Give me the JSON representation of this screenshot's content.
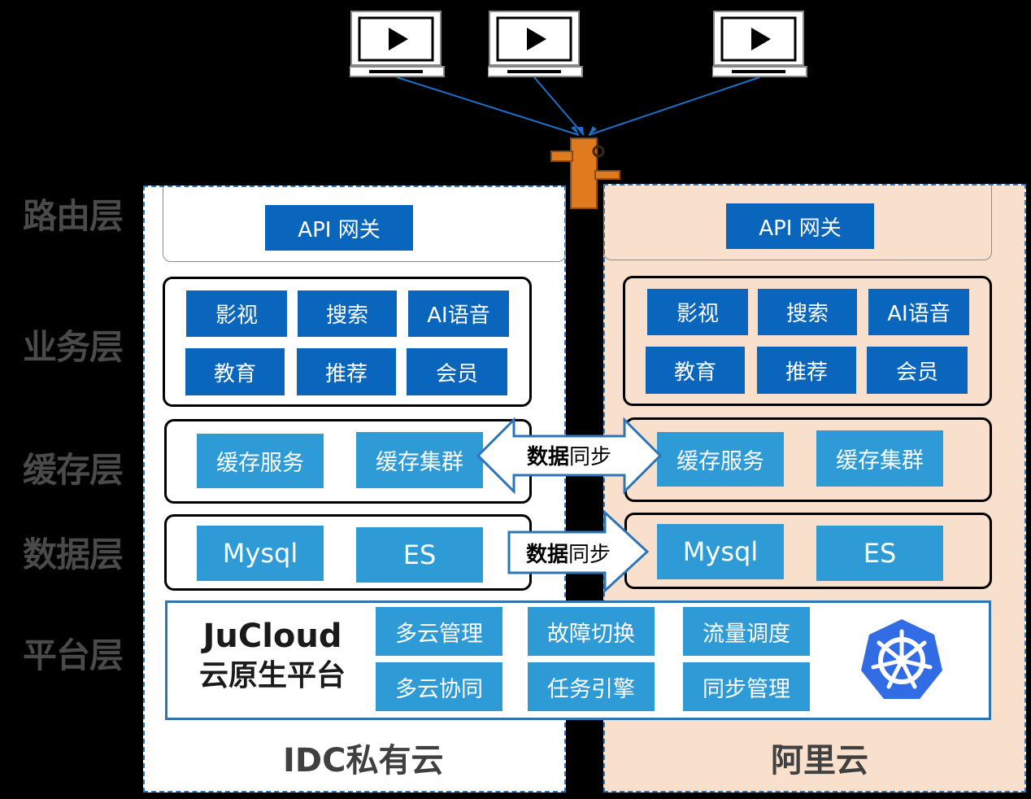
{
  "layers": {
    "route": "路由层",
    "business": "业务层",
    "cache": "缓存层",
    "data": "数据层",
    "platform": "平台层"
  },
  "idc": {
    "name": "IDC私有云",
    "gateway": "API 网关",
    "services": [
      "影视",
      "搜索",
      "AI语音",
      "教育",
      "推荐",
      "会员"
    ],
    "cache": [
      "缓存服务",
      "缓存集群"
    ],
    "data": [
      "Mysql",
      "ES"
    ]
  },
  "aliyun": {
    "name": "阿里云",
    "gateway": "API 网关",
    "services": [
      "影视",
      "搜索",
      "AI语音",
      "教育",
      "推荐",
      "会员"
    ],
    "cache": [
      "缓存服务",
      "缓存集群"
    ],
    "data": [
      "Mysql",
      "ES"
    ]
  },
  "sync": {
    "cache": {
      "bold": "数据",
      "rest": "同步"
    },
    "data": {
      "bold": "数据",
      "rest": "同步"
    }
  },
  "platform": {
    "title_line1": "JuCloud",
    "title_line2": "云原生平台",
    "modules": [
      "多云管理",
      "故障切换",
      "流量调度",
      "多云协同",
      "任务引擎",
      "同步管理"
    ]
  },
  "colors": {
    "dark_blue": "#0a65bd",
    "light_blue": "#2e9bd6",
    "aliyun_bg": "#f8e0cc",
    "router_orange": "#e07a1f",
    "kubernetes_blue": "#326ce5"
  }
}
